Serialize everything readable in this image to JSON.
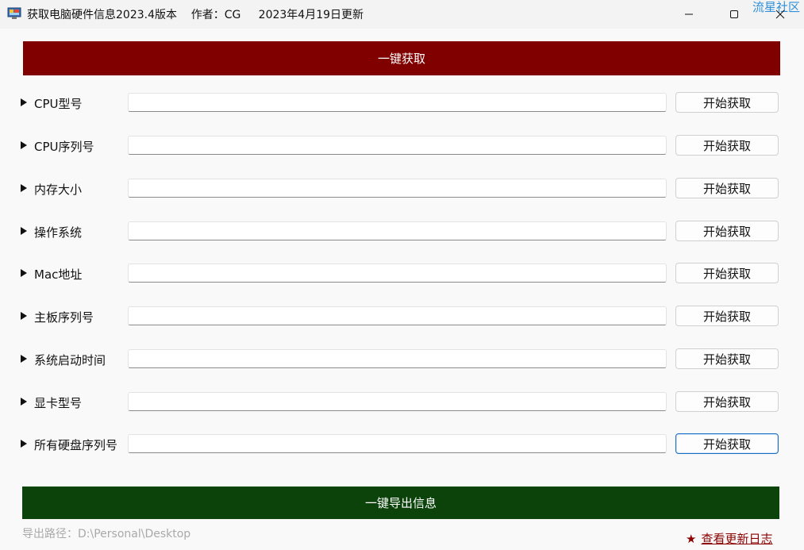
{
  "window": {
    "title": "获取电脑硬件信息2023.4版本    作者：CG     2023年4月19日更新",
    "min_glyph": "—",
    "max_glyph": "☐",
    "close_glyph": "✕",
    "watermark": "流星社区"
  },
  "main": {
    "fetch_all_label": "一键获取",
    "fields": [
      {
        "label": "CPU型号",
        "value": "",
        "button": "开始获取"
      },
      {
        "label": "CPU序列号",
        "value": "",
        "button": "开始获取"
      },
      {
        "label": "内存大小",
        "value": "",
        "button": "开始获取"
      },
      {
        "label": "操作系统",
        "value": "",
        "button": "开始获取"
      },
      {
        "label": "Mac地址",
        "value": "",
        "button": "开始获取"
      },
      {
        "label": "主板序列号",
        "value": "",
        "button": "开始获取"
      },
      {
        "label": "系统启动时间",
        "value": "",
        "button": "开始获取"
      },
      {
        "label": "显卡型号",
        "value": "",
        "button": "开始获取"
      },
      {
        "label": "所有硬盘序列号",
        "value": "",
        "button": "开始获取"
      }
    ],
    "export_all_label": "一键导出信息"
  },
  "footer": {
    "export_path": "导出路径：D:\\Personal\\Desktop",
    "changelog_icon": "★",
    "changelog_label": "查看更新日志"
  },
  "colors": {
    "fetch_button": "#800000",
    "export_button": "#0b430b",
    "changelog_link": "#8a0000",
    "focus_border": "#1a6fc4"
  }
}
